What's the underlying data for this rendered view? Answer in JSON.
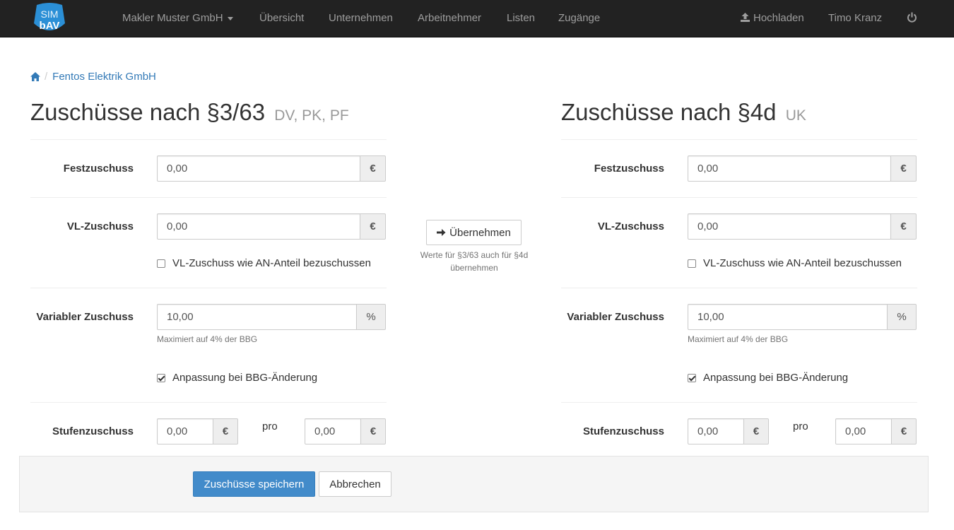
{
  "navbar": {
    "logo_top": "SIM",
    "logo_bottom": "bAV",
    "company": "Makler Muster GmbH",
    "items": [
      "Übersicht",
      "Unternehmen",
      "Arbeitnehmer",
      "Listen",
      "Zugänge"
    ],
    "upload": "Hochladen",
    "user": "Timo Kranz"
  },
  "breadcrumb": {
    "current": "Fentos Elektrik GmbH"
  },
  "left": {
    "title": "Zuschüsse nach §3/63",
    "subtitle": "DV, PK, PF",
    "fest_label": "Festzuschuss",
    "fest_value": "0,00",
    "vl_label": "VL-Zuschuss",
    "vl_value": "0,00",
    "vl_check": "VL-Zuschuss wie AN-Anteil bezuschussen",
    "var_label": "Variabler Zuschuss",
    "var_value": "10,00",
    "var_help": "Maximiert auf 4% der BBG",
    "bbg_check": "Anpassung bei BBG-Änderung",
    "stufen_label": "Stufenzuschuss",
    "stufen_value1": "0,00",
    "stufen_pro": "pro",
    "stufen_value2": "0,00"
  },
  "right": {
    "title": "Zuschüsse nach §4d",
    "subtitle": "UK",
    "fest_label": "Festzuschuss",
    "fest_value": "0,00",
    "vl_label": "VL-Zuschuss",
    "vl_value": "0,00",
    "vl_check": "VL-Zuschuss wie AN-Anteil bezuschussen",
    "var_label": "Variabler Zuschuss",
    "var_value": "10,00",
    "var_help": "Maximiert auf 4% der BBG",
    "bbg_check": "Anpassung bei BBG-Änderung",
    "stufen_label": "Stufenzuschuss",
    "stufen_value1": "0,00",
    "stufen_pro": "pro",
    "stufen_value2": "0,00"
  },
  "middle": {
    "button": "Übernehmen",
    "help": "Werte für §3/63 auch für §4d übernehmen"
  },
  "addons": {
    "euro": "€",
    "percent": "%"
  },
  "footer": {
    "save": "Zuschüsse speichern",
    "cancel": "Abbrechen"
  },
  "icons": {
    "logo": "simbav-logo",
    "home": "home-icon",
    "upload": "upload-icon",
    "power": "power-icon",
    "arrow": "arrow-right-icon"
  },
  "colors": {
    "navbar": "#222222",
    "link": "#337ab7",
    "primary": "#428bca"
  }
}
